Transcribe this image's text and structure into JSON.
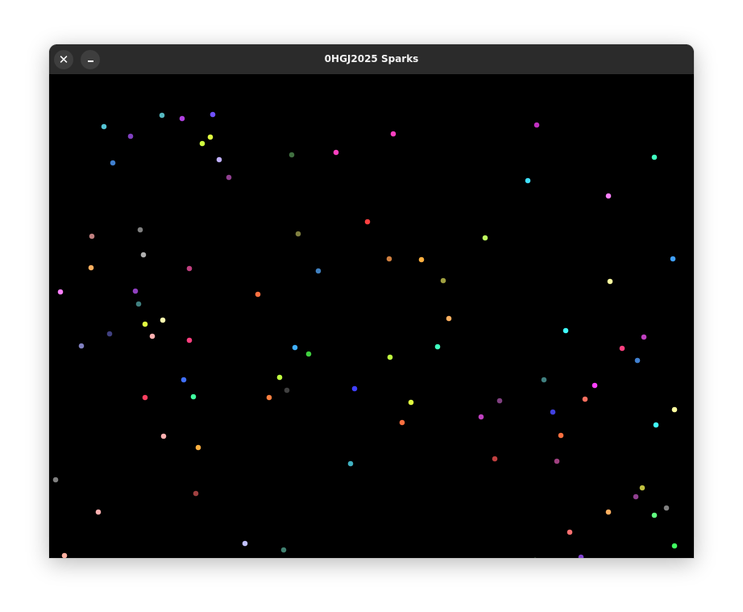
{
  "window": {
    "title": "0HGJ2025 Sparks",
    "close_glyph": "✕"
  },
  "game": {
    "background": "#000000",
    "spark_colors": [
      "#55c4d4",
      "#c030e8",
      "#7060ff",
      "#ff40ff",
      "#ff40c0",
      "#e0e040",
      "#4fc0ff",
      "#60ff60",
      "#ff4040",
      "#ffb050",
      "#c0ff40",
      "#b0b0ff",
      "#ff8080",
      "#40ffc0",
      "#808080",
      "#c04080"
    ]
  }
}
